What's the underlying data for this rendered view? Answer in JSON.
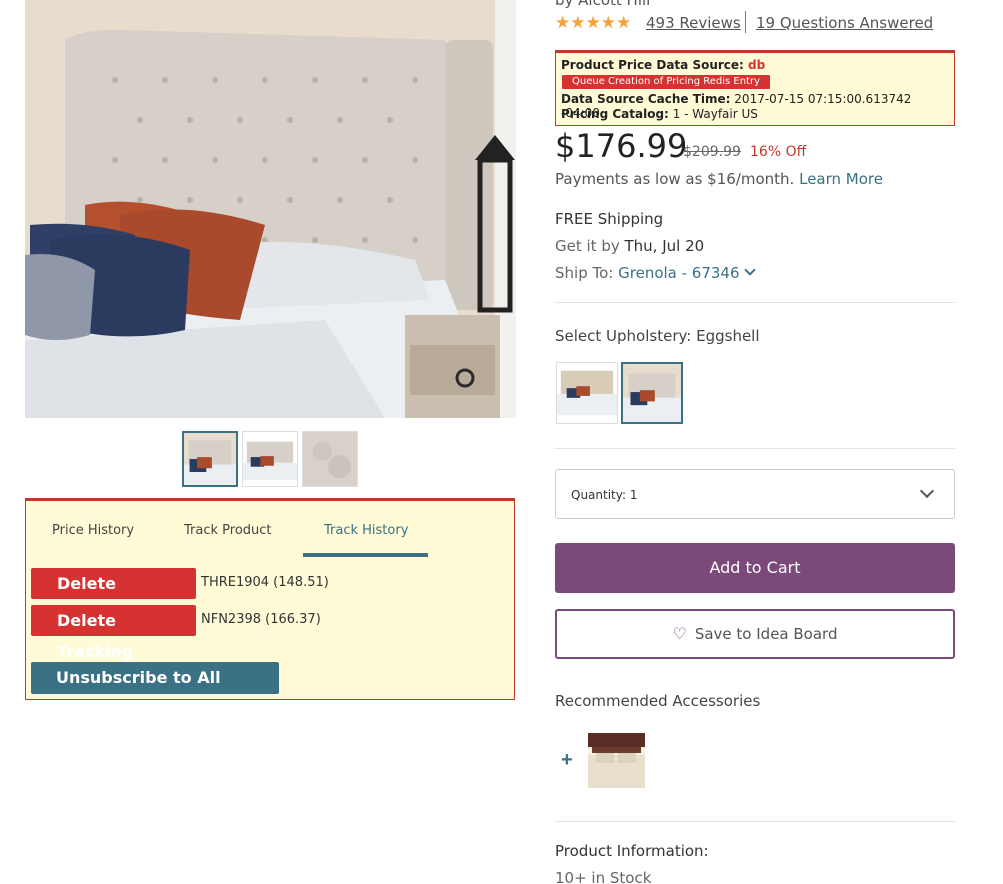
{
  "product": {
    "brand_line": "by Alcott Hill",
    "rating_stars": "★★★★★",
    "reviews_link": "493 Reviews",
    "questions_link": "19 Questions Answered",
    "price": "$176.99",
    "old_price": "$209.99",
    "discount": "16% Off",
    "payments_text": "Payments as low as $16/month.",
    "learn_more": "Learn More"
  },
  "debug_box": {
    "source_label": "Product Price Data Source:",
    "source_value": "db",
    "queue_button": "Queue Creation of Pricing Redis Entry",
    "cache_label": "Data Source Cache Time:",
    "cache_value": "2017-07-15 07:15:00.613742 -04:00",
    "catalog_label": "Pricing Catalog:",
    "catalog_value": "1 - Wayfair US"
  },
  "shipping": {
    "free_shipping": "FREE Shipping",
    "get_it_prefix": "Get it by",
    "get_it_date": "Thu, Jul 20",
    "ship_to_prefix": "Ship To:",
    "ship_to_location": "Grenola - 67346"
  },
  "options": {
    "upholstery_label": "Select Upholstery:",
    "upholstery_value": "Eggshell"
  },
  "purchase": {
    "quantity_label": "Quantity: 1",
    "add_to_cart": "Add to Cart",
    "save_idea_board": "Save to Idea Board"
  },
  "recommended": {
    "title": "Recommended Accessories",
    "plus": "+"
  },
  "info": {
    "title": "Product Information:",
    "stock": "10+ in Stock"
  },
  "tracking": {
    "tabs": [
      "Price History",
      "Track Product",
      "Track History"
    ],
    "active_tab": "Track History",
    "entries": [
      {
        "button": "Delete Tracking",
        "code": "THRE1904 (148.51)"
      },
      {
        "button": "Delete Tracking",
        "code": "NFN2398 (166.37)"
      }
    ],
    "unsubscribe": "Unsubscribe to All Tracking"
  },
  "icons": {
    "heart": "heart-icon",
    "chevron": "chevron-down-icon"
  },
  "colors": {
    "accent_teal": "#3a7185",
    "purchase_purple": "#7b4a7b",
    "alert_red": "#d63232",
    "debug_bg": "#fffbd6",
    "star_orange": "#f2a33a"
  }
}
